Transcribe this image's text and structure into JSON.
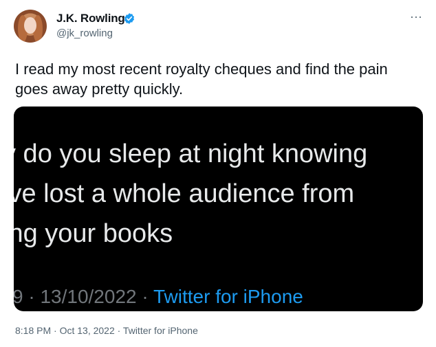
{
  "author": {
    "display_name": "J.K. Rowling",
    "handle": "@jk_rowling",
    "verified_icon": "verified-badge-icon",
    "avatar_icon": "avatar"
  },
  "actions": {
    "more": "···"
  },
  "tweet": {
    "text": "I read my most recent royalty cheques and find the pain goes away pretty quickly."
  },
  "media": {
    "lines": [
      "v do you sleep at night knowing",
      "’ve lost a whole audience from",
      "ing your books"
    ],
    "meta_prefix": "9 · 13/10/2022 · ",
    "meta_source": "Twitter for iPhone"
  },
  "footer": {
    "timestamp": "8:18 PM · Oct 13, 2022 · Twitter for iPhone"
  },
  "colors": {
    "accent": "#1d9bf0",
    "text": "#0f1419",
    "muted": "#536471"
  }
}
